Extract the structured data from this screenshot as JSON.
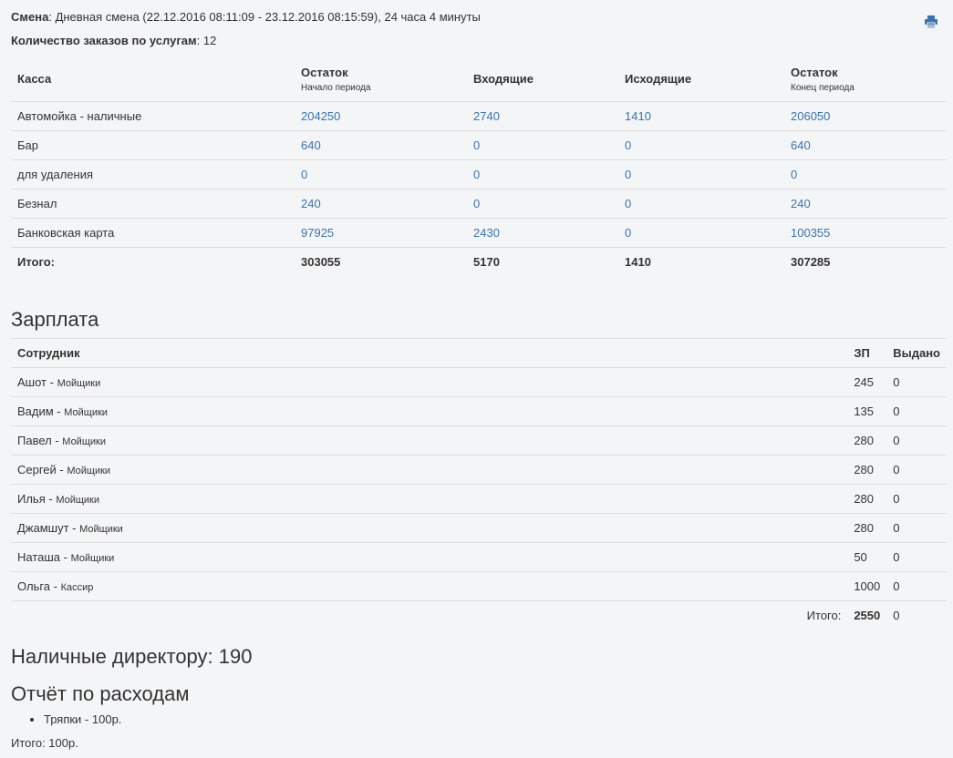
{
  "shift": {
    "label": "Смена",
    "value": "Дневная смена (22.12.2016 08:11:09 - 23.12.2016 08:15:59), 24 часа 4 минуты"
  },
  "orders": {
    "label": "Количество заказов по услугам",
    "value": "12"
  },
  "print_icon": "printer-icon",
  "cash_table": {
    "headers": {
      "kassa": "Касса",
      "start": "Остаток",
      "start_sub": "Начало периода",
      "incoming": "Входящие",
      "outgoing": "Исходящие",
      "end": "Остаток",
      "end_sub": "Конец периода"
    },
    "rows": [
      {
        "name": "Автомойка - наличные",
        "start": "204250",
        "incoming": "2740",
        "outgoing": "1410",
        "end": "206050"
      },
      {
        "name": "Бар",
        "start": "640",
        "incoming": "0",
        "outgoing": "0",
        "end": "640"
      },
      {
        "name": "для удаления",
        "start": "0",
        "incoming": "0",
        "outgoing": "0",
        "end": "0"
      },
      {
        "name": "Безнал",
        "start": "240",
        "incoming": "0",
        "outgoing": "0",
        "end": "240"
      },
      {
        "name": "Банковская карта",
        "start": "97925",
        "incoming": "2430",
        "outgoing": "0",
        "end": "100355"
      }
    ],
    "total": {
      "label": "Итого:",
      "start": "303055",
      "incoming": "5170",
      "outgoing": "1410",
      "end": "307285"
    }
  },
  "salary": {
    "title": "Зарплата",
    "headers": {
      "employee": "Сотрудник",
      "zp": "ЗП",
      "issued": "Выдано"
    },
    "rows": [
      {
        "name": "Ашот",
        "role": "Мойщики",
        "zp": "245",
        "issued": "0"
      },
      {
        "name": "Вадим",
        "role": "Мойщики",
        "zp": "135",
        "issued": "0"
      },
      {
        "name": "Павел",
        "role": "Мойщики",
        "zp": "280",
        "issued": "0"
      },
      {
        "name": "Сергей",
        "role": "Мойщики",
        "zp": "280",
        "issued": "0"
      },
      {
        "name": "Илья",
        "role": "Мойщики",
        "zp": "280",
        "issued": "0"
      },
      {
        "name": "Джамшут",
        "role": "Мойщики",
        "zp": "280",
        "issued": "0"
      },
      {
        "name": "Наташа",
        "role": "Мойщики",
        "zp": "50",
        "issued": "0"
      },
      {
        "name": "Ольга",
        "role": "Кассир",
        "zp": "1000",
        "issued": "0"
      }
    ],
    "total": {
      "label": "Итого:",
      "zp": "2550",
      "issued": "0"
    }
  },
  "director_cash": "Наличные директору: 190",
  "expenses": {
    "title": "Отчёт по расходам",
    "items": [
      "Тряпки - 100р."
    ],
    "total": "Итого: 100р."
  }
}
